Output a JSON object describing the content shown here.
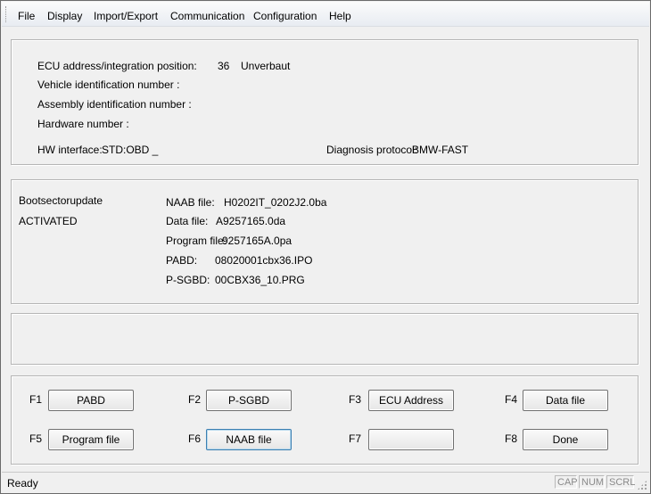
{
  "menu": {
    "items": [
      "File",
      "Display",
      "Import/Export",
      "Communication",
      "Configuration",
      "Help"
    ]
  },
  "ecu_info": {
    "address_label": "ECU address/integration position:",
    "address_value": "36",
    "address_status": "Unverbaut",
    "vehicle_id_label": "Vehicle identification number :",
    "assembly_id_label": "Assembly identification number :",
    "hardware_number_label": "Hardware number :",
    "hw_interface_label": "HW interface:",
    "hw_interface_value": "STD:OBD _",
    "diag_protocol_label": "Diagnosis protocol:",
    "diag_protocol_value": "BMW-FAST"
  },
  "files": {
    "mode_label": "Bootsectorupdate",
    "mode_status": "ACTIVATED",
    "naab_label": "NAAB file:",
    "naab_value": "H0202IT_0202J2.0ba",
    "data_label": "Data file:",
    "data_value": "A9257165.0da",
    "program_label": "Program file:",
    "program_value": "9257165A.0pa",
    "pabd_label": "PABD:",
    "pabd_value": "08020001cbx36.IPO",
    "psgbd_label": "P-SGBD:",
    "psgbd_value": "00CBX36_10.PRG"
  },
  "buttons": {
    "f1": {
      "key": "F1",
      "label": "PABD"
    },
    "f2": {
      "key": "F2",
      "label": "P-SGBD"
    },
    "f3": {
      "key": "F3",
      "label": "ECU Address"
    },
    "f4": {
      "key": "F4",
      "label": "Data file"
    },
    "f5": {
      "key": "F5",
      "label": "Program file"
    },
    "f6": {
      "key": "F6",
      "label": "NAAB file"
    },
    "f7": {
      "key": "F7",
      "label": ""
    },
    "f8": {
      "key": "F8",
      "label": "Done"
    }
  },
  "status": {
    "text": "Ready",
    "cap": "CAP",
    "num": "NUM",
    "scrl": "SCRL"
  }
}
